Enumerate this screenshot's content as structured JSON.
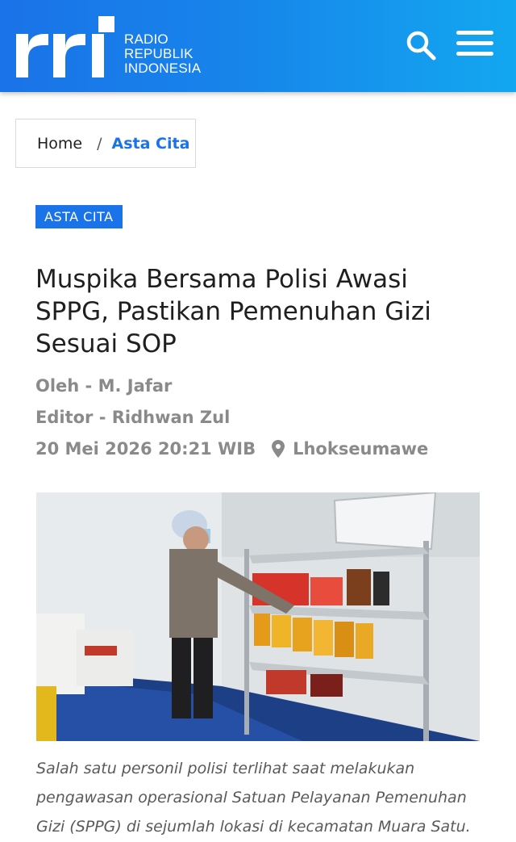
{
  "header": {
    "logo_text": "rri",
    "brand_line1": "RADIO",
    "brand_line2": "REPUBLIK",
    "brand_line3": "INDONESIA",
    "search_icon": "search-icon",
    "menu_icon": "hamburger-menu-icon"
  },
  "breadcrumb": {
    "home": "Home",
    "separator": "/",
    "current": "Asta Cita"
  },
  "article": {
    "category": "ASTA CITA",
    "title": "Muspika Bersama Polisi Awasi SPPG, Pastikan Pemenuhan Gizi Sesuai SOP",
    "author": "Oleh - M. Jafar",
    "editor": "Editor - Ridhwan Zul",
    "datetime": "20 Mei 2026 20:21 WIB",
    "location_icon": "location-pin-icon",
    "location": "Lhokseumawe",
    "photo_caption": "Salah satu personil polisi terlihat saat melakukan pengawasan operasional Satuan Pelayanan Pemenuhan Gizi (SPPG) di sejumlah lokasi di kecamatan Muara Satu."
  },
  "colors": {
    "brand_blue": "#1a73e8",
    "header_gradient_end": "#13a7f0",
    "meta_gray": "#8a8a8a"
  }
}
